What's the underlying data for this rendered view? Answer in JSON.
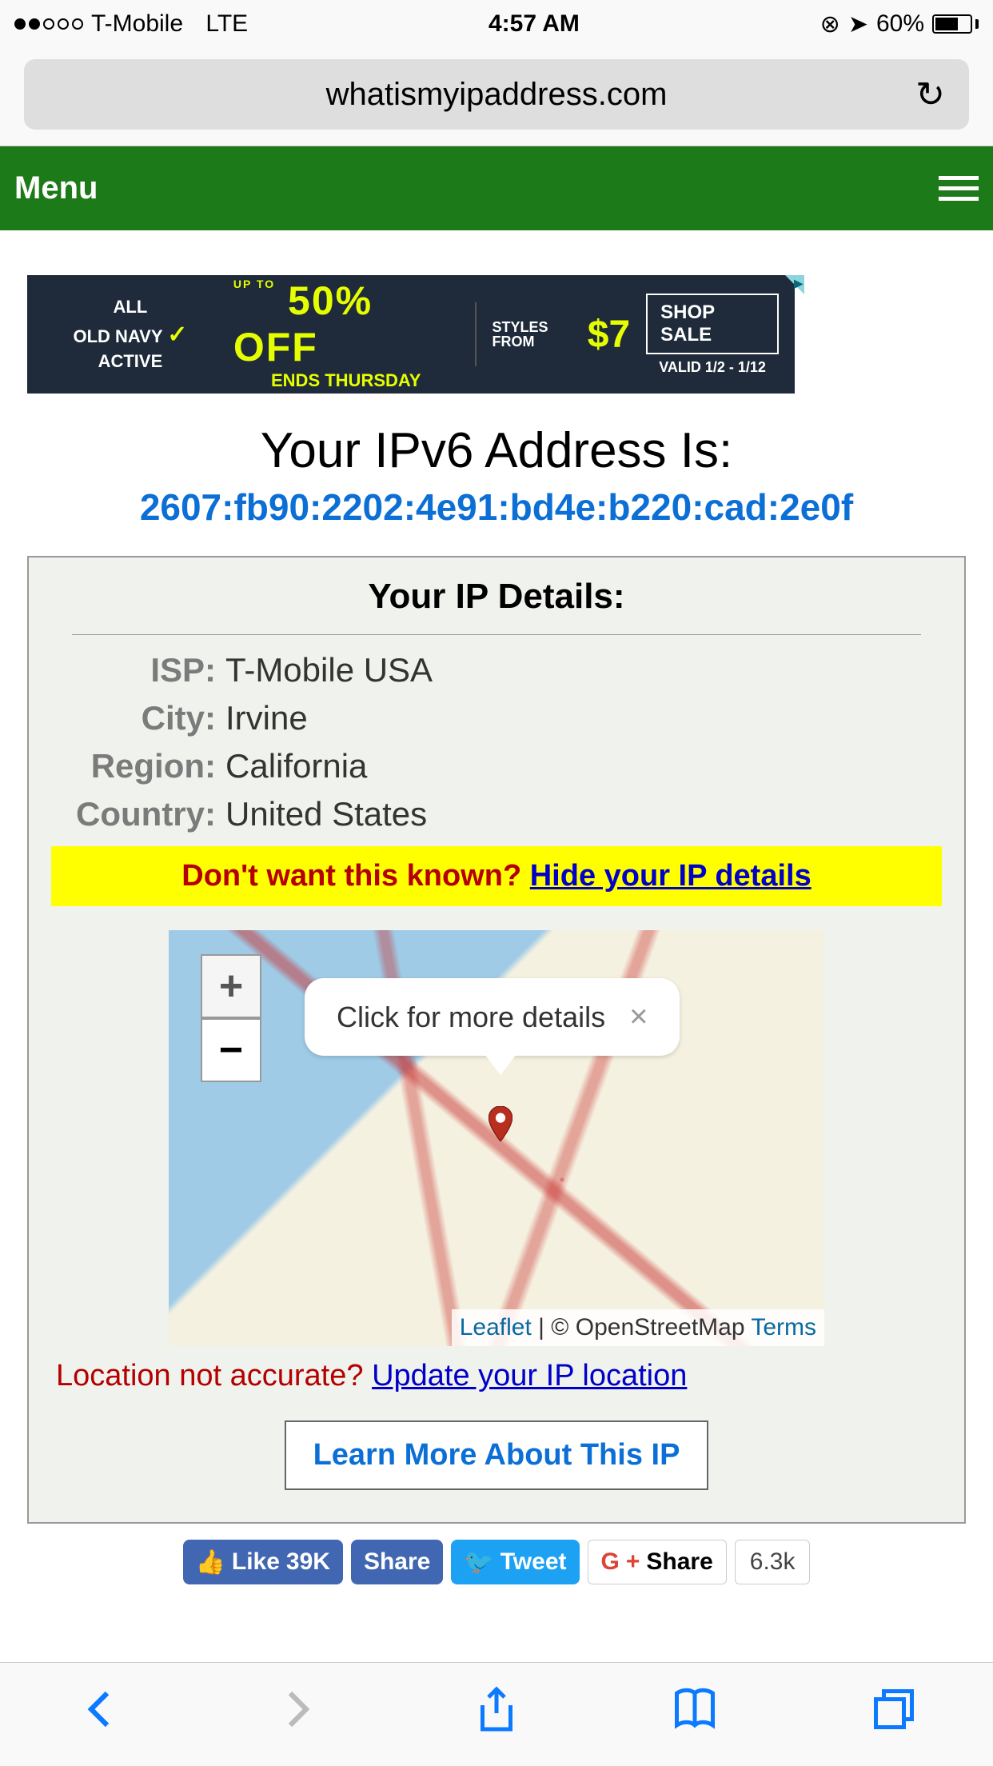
{
  "status": {
    "carrier": "T-Mobile",
    "network": "LTE",
    "time": "4:57 AM",
    "battery_pct": "60%"
  },
  "browser": {
    "url": "whatismyipaddress.com"
  },
  "menu": {
    "label": "Menu"
  },
  "ad": {
    "left_top": "ALL",
    "left_bottom": "OLD NAVY",
    "left_brand": "ACTIVE",
    "up_to": "UP TO",
    "pct": "50% OFF",
    "ends": "ENDS THURSDAY",
    "styles_from": "STYLES FROM",
    "price": "$7",
    "shop": "SHOP SALE",
    "valid": "VALID 1/2 - 1/12"
  },
  "ipv6": {
    "heading": "Your IPv6 Address Is:",
    "address": "2607:fb90:2202:4e91:bd4e:b220:cad:2e0f"
  },
  "details": {
    "title": "Your IP Details:",
    "rows": {
      "isp_label": "ISP:",
      "isp_value": "T-Mobile USA",
      "city_label": "City:",
      "city_value": "Irvine",
      "region_label": "Region:",
      "region_value": "California",
      "country_label": "Country:",
      "country_value": "United States"
    }
  },
  "hide_banner": {
    "question": "Don't want this known? ",
    "link": "Hide your IP details"
  },
  "map": {
    "zoom_in": "+",
    "zoom_out": "−",
    "popup_text": "Click for more details",
    "attrib_leaflet": "Leaflet",
    "attrib_sep": " | © ",
    "attrib_osm": "OpenStreetMap ",
    "attrib_terms": "Terms"
  },
  "location_line": {
    "question": "Location not accurate? ",
    "link": "Update your IP location"
  },
  "learn_more": "Learn More About This IP",
  "social": {
    "fb_like": "Like",
    "fb_count": "39K",
    "fb_share": "Share",
    "tweet": "Tweet",
    "gplus_share": "Share",
    "count": "6.3k"
  }
}
